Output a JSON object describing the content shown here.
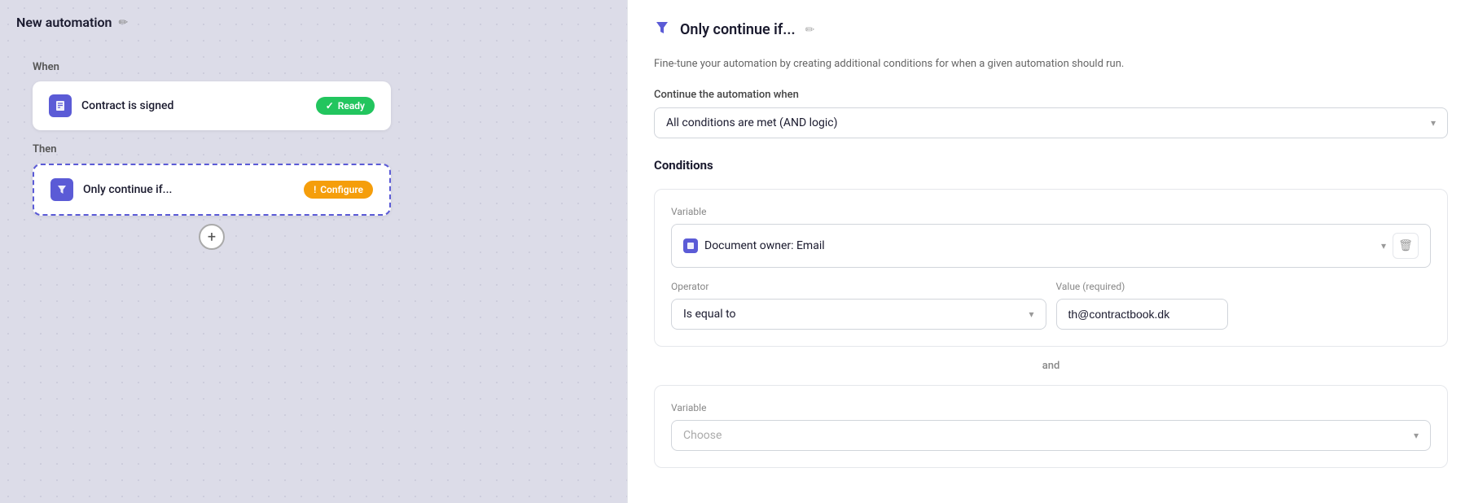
{
  "leftPanel": {
    "title": "New automation",
    "whenLabel": "When",
    "thenLabel": "Then",
    "contractStep": {
      "title": "Contract is signed",
      "badge": "Ready"
    },
    "filterStep": {
      "title": "Only continue if...",
      "badge": "Configure"
    },
    "addButtonLabel": "+"
  },
  "rightPanel": {
    "title": "Only continue if...",
    "description": "Fine-tune your automation by creating additional conditions for when a given automation should run.",
    "continueWhenLabel": "Continue the automation when",
    "continueWhenValue": "All conditions are met (AND logic)",
    "conditionsTitle": "Conditions",
    "condition1": {
      "variableLabel": "Variable",
      "variableValue": "Document owner: Email",
      "operatorLabel": "Operator",
      "operatorValue": "Is equal to",
      "valueLabel": "Value (required)",
      "valueValue": "th@contractbook.dk"
    },
    "andLabel": "and",
    "condition2": {
      "variableLabel": "Variable",
      "variablePlaceholder": "Choose"
    }
  },
  "icons": {
    "edit": "✏",
    "filter": "⊿",
    "chevronDown": "▾",
    "check": "✓",
    "warning": "!",
    "doc": "📄",
    "trash": "🗑",
    "plus": "+"
  }
}
